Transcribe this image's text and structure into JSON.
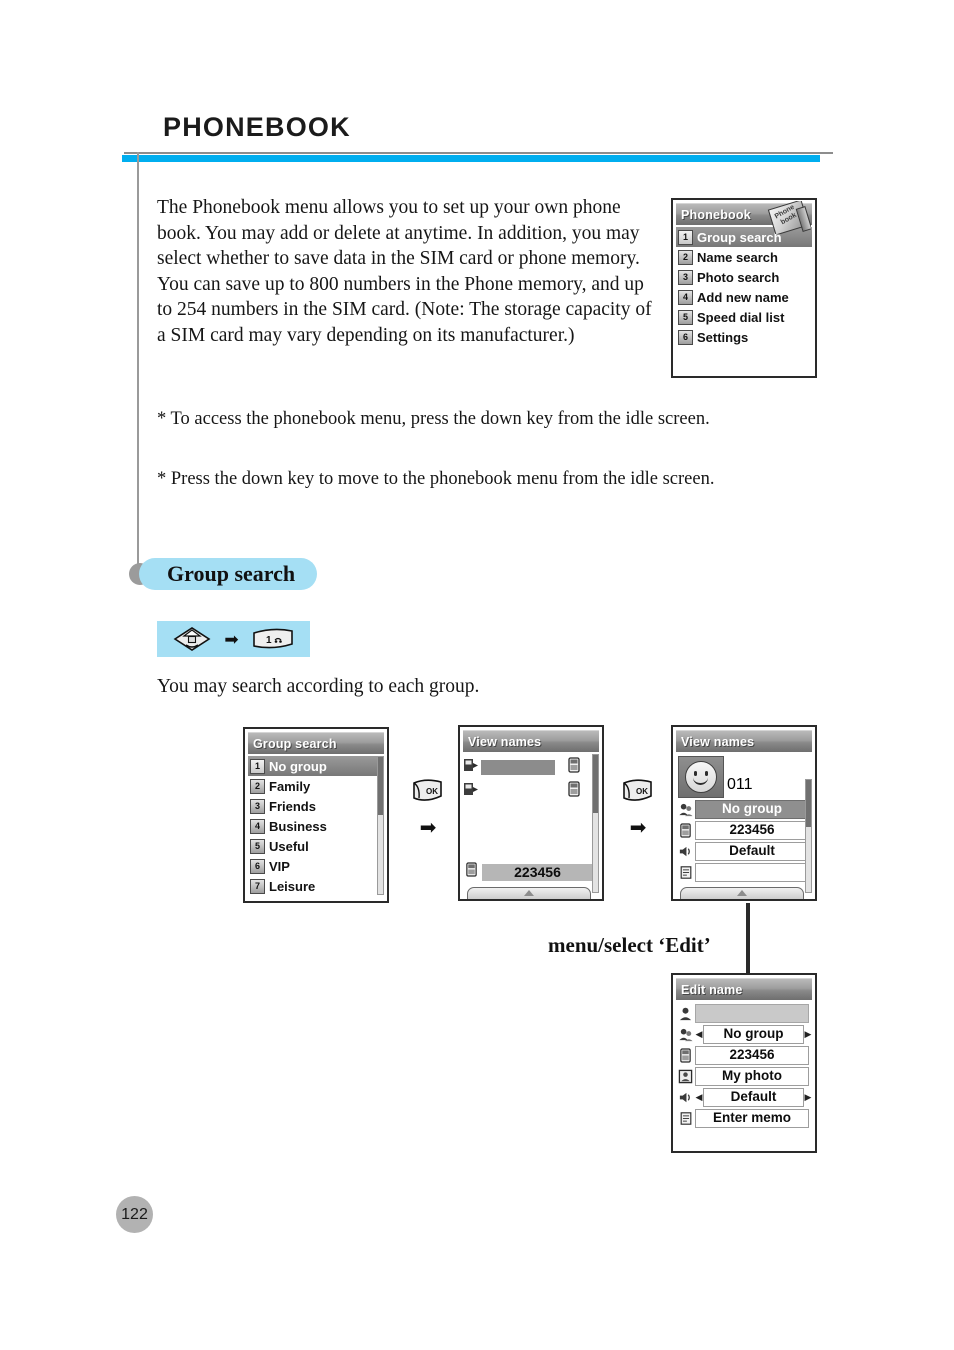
{
  "document": {
    "chapter_title": "PHONEBOOK",
    "page_number": "122",
    "accent_color": "#00aeef",
    "pill_color": "#a5dff4"
  },
  "intro": {
    "paragraph": "The Phonebook menu allows you to set up your own phone book. You may add or delete at anytime. In addition, you may select whether to save data in the SIM card or phone memory. You can save up to 800 numbers in the Phone memory, and up to 254 numbers in the SIM card. (Note: The storage capacity of a SIM card may vary depending on its manufacturer.)",
    "note1": "* To access the phonebook menu, press the down key from the idle screen.",
    "note2": "* Press the down key to move to the phonebook menu from the idle screen."
  },
  "section": {
    "heading": "Group search",
    "lead": "You may search according to each group.",
    "key_sequence": {
      "key1": "navigation-down-key",
      "arrow": "➡",
      "key2_label": "1"
    }
  },
  "screens": {
    "phonebook_menu": {
      "title": "Phonebook",
      "book_art_line1": "Phone",
      "book_art_line2": "book",
      "items": [
        {
          "num": "1",
          "label": "Group search",
          "selected": true
        },
        {
          "num": "2",
          "label": "Name search",
          "selected": false
        },
        {
          "num": "3",
          "label": "Photo search",
          "selected": false
        },
        {
          "num": "4",
          "label": "Add new name",
          "selected": false
        },
        {
          "num": "5",
          "label": "Speed dial list",
          "selected": false
        },
        {
          "num": "6",
          "label": "Settings",
          "selected": false
        }
      ]
    },
    "group_search": {
      "title": "Group search",
      "items": [
        {
          "num": "1",
          "label": "No group",
          "selected": true
        },
        {
          "num": "2",
          "label": "Family",
          "selected": false
        },
        {
          "num": "3",
          "label": "Friends",
          "selected": false
        },
        {
          "num": "4",
          "label": "Business",
          "selected": false
        },
        {
          "num": "5",
          "label": "Useful",
          "selected": false
        },
        {
          "num": "6",
          "label": "VIP",
          "selected": false
        },
        {
          "num": "7",
          "label": "Leisure",
          "selected": false
        }
      ]
    },
    "view_names_list": {
      "title": "View names",
      "rows": [
        {
          "name": "",
          "selected": true
        },
        {
          "name": "",
          "selected": false
        }
      ],
      "bottom_value": "223456"
    },
    "view_names_detail": {
      "title": "View names",
      "avatar": "smiley-avatar",
      "name_value": "",
      "number_value": "011",
      "group_value": "No group",
      "phone_value": "223456",
      "ring_value": "Default",
      "memo_value": ""
    },
    "edit_name": {
      "title": "Edit name",
      "name_value": "",
      "group_value": "No group",
      "phone_value": "223456",
      "photo_value": "My photo",
      "ring_value": "Default",
      "memo_value": "Enter memo",
      "caret_left": "◀",
      "caret_right": "▶"
    }
  },
  "flow": {
    "transition1_key": "OK",
    "transition1_arrow": "➡",
    "transition2_key": "OK",
    "transition2_arrow": "➡",
    "edit_caption": "menu/select ‘Edit’"
  }
}
